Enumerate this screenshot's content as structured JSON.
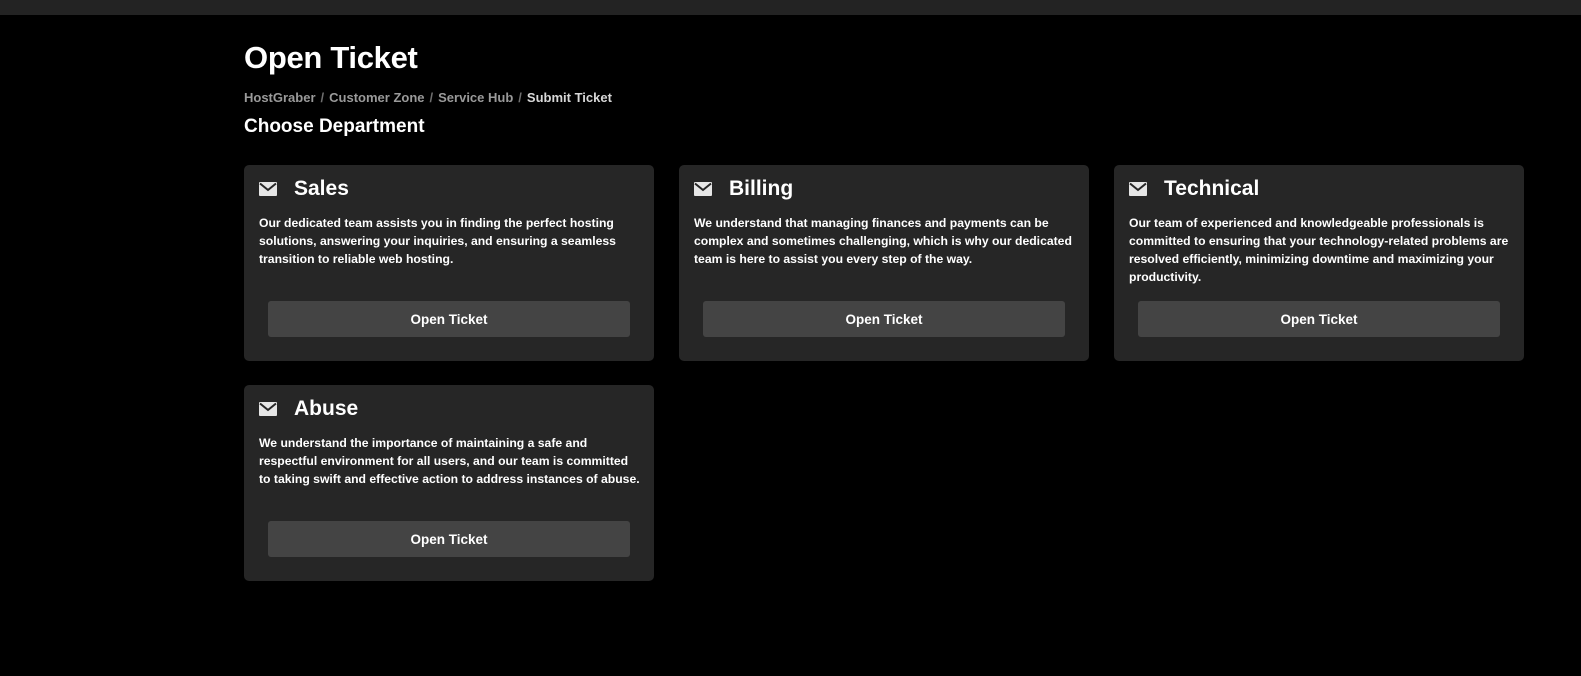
{
  "page": {
    "title": "Open Ticket",
    "section_title": "Choose Department"
  },
  "breadcrumb": {
    "items": [
      "HostGraber",
      "Customer Zone",
      "Service Hub",
      "Submit Ticket"
    ],
    "separator": "/"
  },
  "departments": [
    {
      "icon": "envelope-icon",
      "title": "Sales",
      "description": "Our dedicated team assists you in finding the perfect hosting solutions, answering your inquiries, and ensuring a seamless transition to reliable web hosting.",
      "button_label": "Open Ticket"
    },
    {
      "icon": "envelope-icon",
      "title": "Billing",
      "description": "We understand that managing finances and payments can be complex and sometimes challenging, which is why our dedicated team is here to assist you every step of the way.",
      "button_label": "Open Ticket"
    },
    {
      "icon": "envelope-icon",
      "title": "Technical",
      "description": "Our team of experienced and knowledgeable professionals is committed to ensuring that your technology-related problems are resolved efficiently, minimizing downtime and maximizing your productivity.",
      "button_label": "Open Ticket"
    },
    {
      "icon": "envelope-icon",
      "title": "Abuse",
      "description": "We understand the importance of maintaining a safe and respectful environment for all users, and our team is committed to taking swift and effective action to address instances of abuse.",
      "button_label": "Open Ticket"
    }
  ],
  "colors": {
    "background": "#000000",
    "card": "#262626",
    "button": "#444444",
    "top_strip": "#232323"
  }
}
